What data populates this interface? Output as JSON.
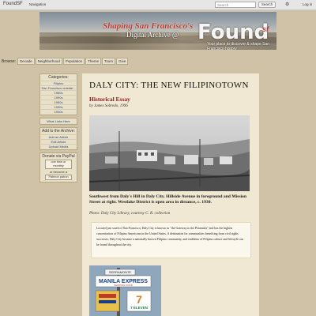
{
  "topbar": {
    "brand": "FoundSF",
    "nav": "Navigation",
    "search_placeholder": "Search",
    "search_button": "Search",
    "gear_icon": "gear-icon",
    "login": "Log in"
  },
  "banner": {
    "line1": "Shaping San Francisco's",
    "line2": "Digital Archive @",
    "found": "Found",
    "sf": "sf",
    "tagline": "Your place to discover & shape San Francisco history"
  },
  "browse": {
    "label": "Browse:",
    "tabs": [
      "Decade",
      "Neighborhood",
      "Population",
      "Theme",
      "Tours",
      "Give"
    ]
  },
  "sidebar": {
    "categories_title": "Categories:",
    "categories": [
      "Filipino",
      "San Francisco outside...",
      "1960s",
      "1990s",
      "1950s",
      "1930s",
      "1940s"
    ],
    "what_links": "What Links Here",
    "add_title": "Add to the Archive:",
    "add_links": [
      "Add an Article",
      "Edit Article",
      "Upload Media"
    ],
    "donate_title": "Donate via PayPal",
    "donate_btn": "one time or monthly",
    "or": "or become a",
    "patron_btn": "Patreon patron"
  },
  "article": {
    "title": "DALY CITY: THE NEW FILIPINOTOWN",
    "subtitle": "Historical Essay",
    "byline": "by James Sobredo, 1996",
    "caption": "Southwest from Daly's Hill in Daly City. Hillside Avenue in foreground and Mission Street at right. Westlake District is open area in distance, c. 1930.",
    "credit": "Photo: Daly City Library, courtesy C. R. collection",
    "intro": "Located just south of San Francisco, Daly City is known as \"the Gateway to the Peninsula\" and has the highest concentration of Filipino Americans in the United States. A destination for communities benefiting from civil rights successes, Daly City became a nationally known Filipino community, and emblems of Filipino culture and lifestyle can be found throughout the city.",
    "sign_top": "SERRAMONTE",
    "sign_main": "MANILA EXPRESS",
    "sign_sub": "SHIPPING FOOD",
    "sign_eleven": "7 ELEVEN"
  }
}
